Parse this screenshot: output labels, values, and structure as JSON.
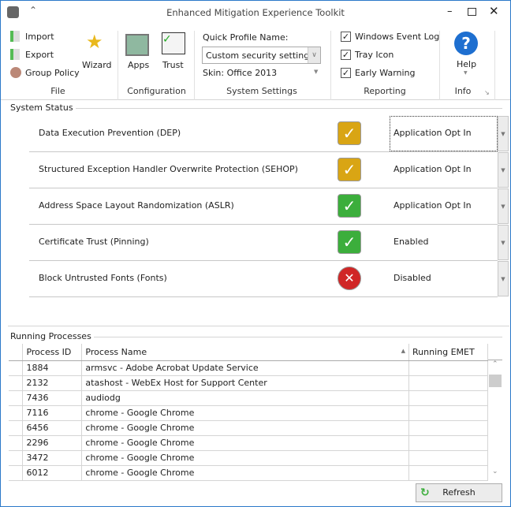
{
  "window": {
    "title": "Enhanced Mitigation Experience Toolkit"
  },
  "ribbon": {
    "file": {
      "import": "Import",
      "export": "Export",
      "group_policy": "Group Policy",
      "wizard": "Wizard",
      "label": "File"
    },
    "configuration": {
      "apps": "Apps",
      "trust": "Trust",
      "label": "Configuration"
    },
    "system_settings": {
      "quick_profile_label": "Quick Profile Name:",
      "quick_profile_value": "Custom security settings",
      "skin": "Skin: Office 2013",
      "label": "System Settings"
    },
    "reporting": {
      "items": [
        {
          "label": "Windows Event Log",
          "checked": true
        },
        {
          "label": "Tray Icon",
          "checked": true
        },
        {
          "label": "Early Warning",
          "checked": true
        }
      ],
      "label": "Reporting"
    },
    "info": {
      "help": "Help",
      "label": "Info"
    }
  },
  "system_status": {
    "title": "System Status",
    "items": [
      {
        "name": "Data Execution Prevention (DEP)",
        "status": "warning",
        "value": "Application Opt In"
      },
      {
        "name": "Structured Exception Handler Overwrite Protection (SEHOP)",
        "status": "warning",
        "value": "Application Opt In"
      },
      {
        "name": "Address Space Layout Randomization (ASLR)",
        "status": "ok",
        "value": "Application Opt In"
      },
      {
        "name": "Certificate Trust (Pinning)",
        "status": "ok",
        "value": "Enabled"
      },
      {
        "name": "Block Untrusted Fonts (Fonts)",
        "status": "error",
        "value": "Disabled"
      }
    ]
  },
  "processes": {
    "title": "Running Processes",
    "columns": [
      "Process ID",
      "Process Name",
      "Running EMET"
    ],
    "sort": "Process Name ascending",
    "rows": [
      [
        "1884",
        "armsvc - Adobe Acrobat Update Service",
        ""
      ],
      [
        "2132",
        "atashost - WebEx Host for Support Center",
        ""
      ],
      [
        "7436",
        "audiodg",
        ""
      ],
      [
        "7116",
        "chrome - Google Chrome",
        ""
      ],
      [
        "6456",
        "chrome - Google Chrome",
        ""
      ],
      [
        "2296",
        "chrome - Google Chrome",
        ""
      ],
      [
        "3472",
        "chrome - Google Chrome",
        ""
      ],
      [
        "6012",
        "chrome - Google Chrome",
        ""
      ]
    ],
    "refresh": "Refresh"
  },
  "colors": {
    "warning": "#d9a514",
    "ok": "#3cae3c",
    "error": "#d02626",
    "border": "#2b79c9"
  }
}
